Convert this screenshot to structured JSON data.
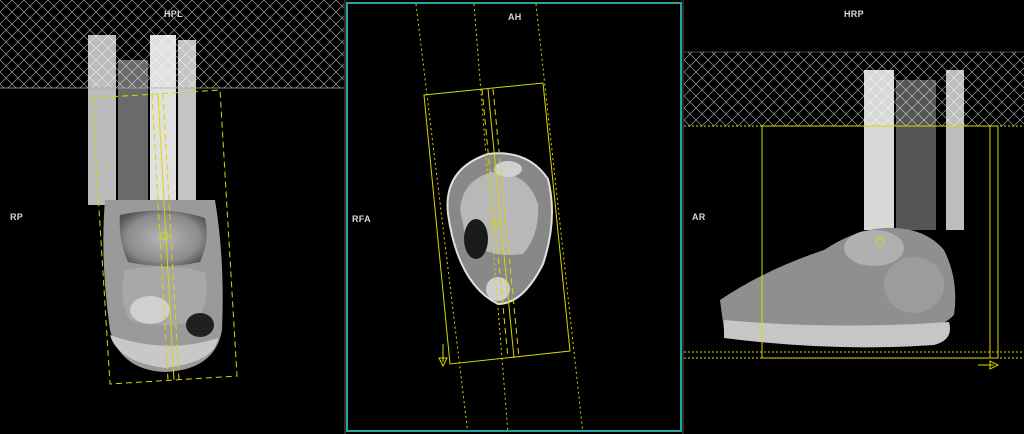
{
  "viewports": {
    "coronal": {
      "top_label": "HPL",
      "left_label": "RP"
    },
    "axial": {
      "top_label": "AH",
      "left_label": "RFA"
    },
    "sagittal": {
      "top_label": "HRP",
      "left_label": "AR"
    }
  },
  "colors": {
    "active_border": "#2aa3a3",
    "planning_box": "#d8d800",
    "saturation_hatch": "#ffffff",
    "background": "#000000"
  },
  "icons": {
    "phase_arrow_axial": "down-arrow-icon",
    "phase_arrow_sagittal": "right-arrow-icon",
    "slice_center": "circle-marker-icon"
  }
}
